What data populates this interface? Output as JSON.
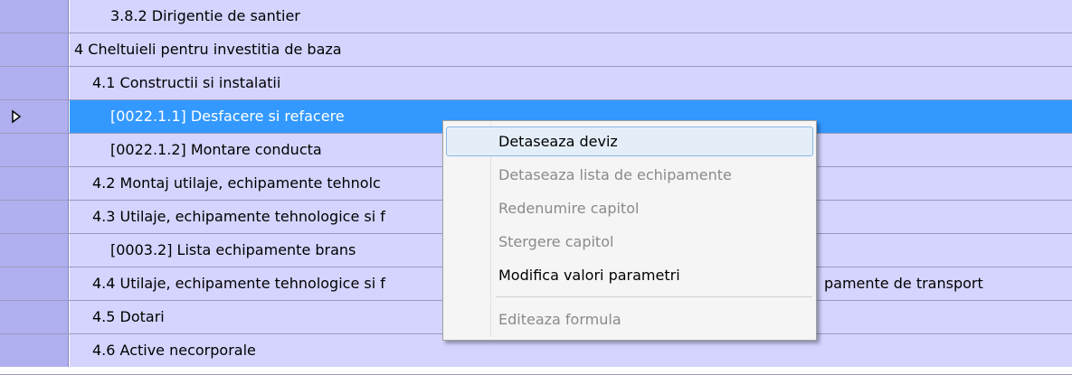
{
  "grid": {
    "rows": [
      {
        "label": "3.8.2 Dirigentie de santier",
        "level": 2,
        "selected": false
      },
      {
        "label": "4 Cheltuieli pentru investitia de baza",
        "level": 0,
        "selected": false
      },
      {
        "label": "4.1 Constructii si instalatii",
        "level": 1,
        "selected": false
      },
      {
        "label": "[0022.1.1] Desfacere si refacere",
        "level": 2,
        "selected": true
      },
      {
        "label": "[0022.1.2] Montare conducta",
        "level": 2,
        "selected": false
      },
      {
        "label": "4.2 Montaj utilaje, echipamente tehnolc",
        "level": 1,
        "selected": false
      },
      {
        "label": "4.3 Utilaje, echipamente tehnologice si f",
        "level": 1,
        "selected": false
      },
      {
        "label": "[0003.2] Lista echipamente brans",
        "level": 2,
        "selected": false
      },
      {
        "label": "4.4 Utilaje, echipamente tehnologice si f",
        "level": 1,
        "selected": false
      },
      {
        "label": "4.5 Dotari",
        "level": 1,
        "selected": false
      },
      {
        "label": "4.6 Active necorporale",
        "level": 1,
        "selected": false
      }
    ],
    "row_tail_text": "pamente de transport",
    "current_row_icon": "row-pointer-icon"
  },
  "context_menu": {
    "items": [
      {
        "label": "Detaseaza deviz",
        "enabled": true,
        "hover": true
      },
      {
        "label": "Detaseaza lista de echipamente",
        "enabled": false
      },
      {
        "label": "Redenumire capitol",
        "enabled": false
      },
      {
        "label": "Stergere capitol",
        "enabled": false
      },
      {
        "label": "Modifica valori parametri",
        "enabled": true
      },
      {
        "label": "Editeaza formula",
        "enabled": false
      }
    ]
  },
  "colors": {
    "row_bg": "#d4d4ff",
    "indicator_bg": "#b0b0f0",
    "selection": "#3399ff",
    "menu_bg": "#f5f5f5"
  }
}
